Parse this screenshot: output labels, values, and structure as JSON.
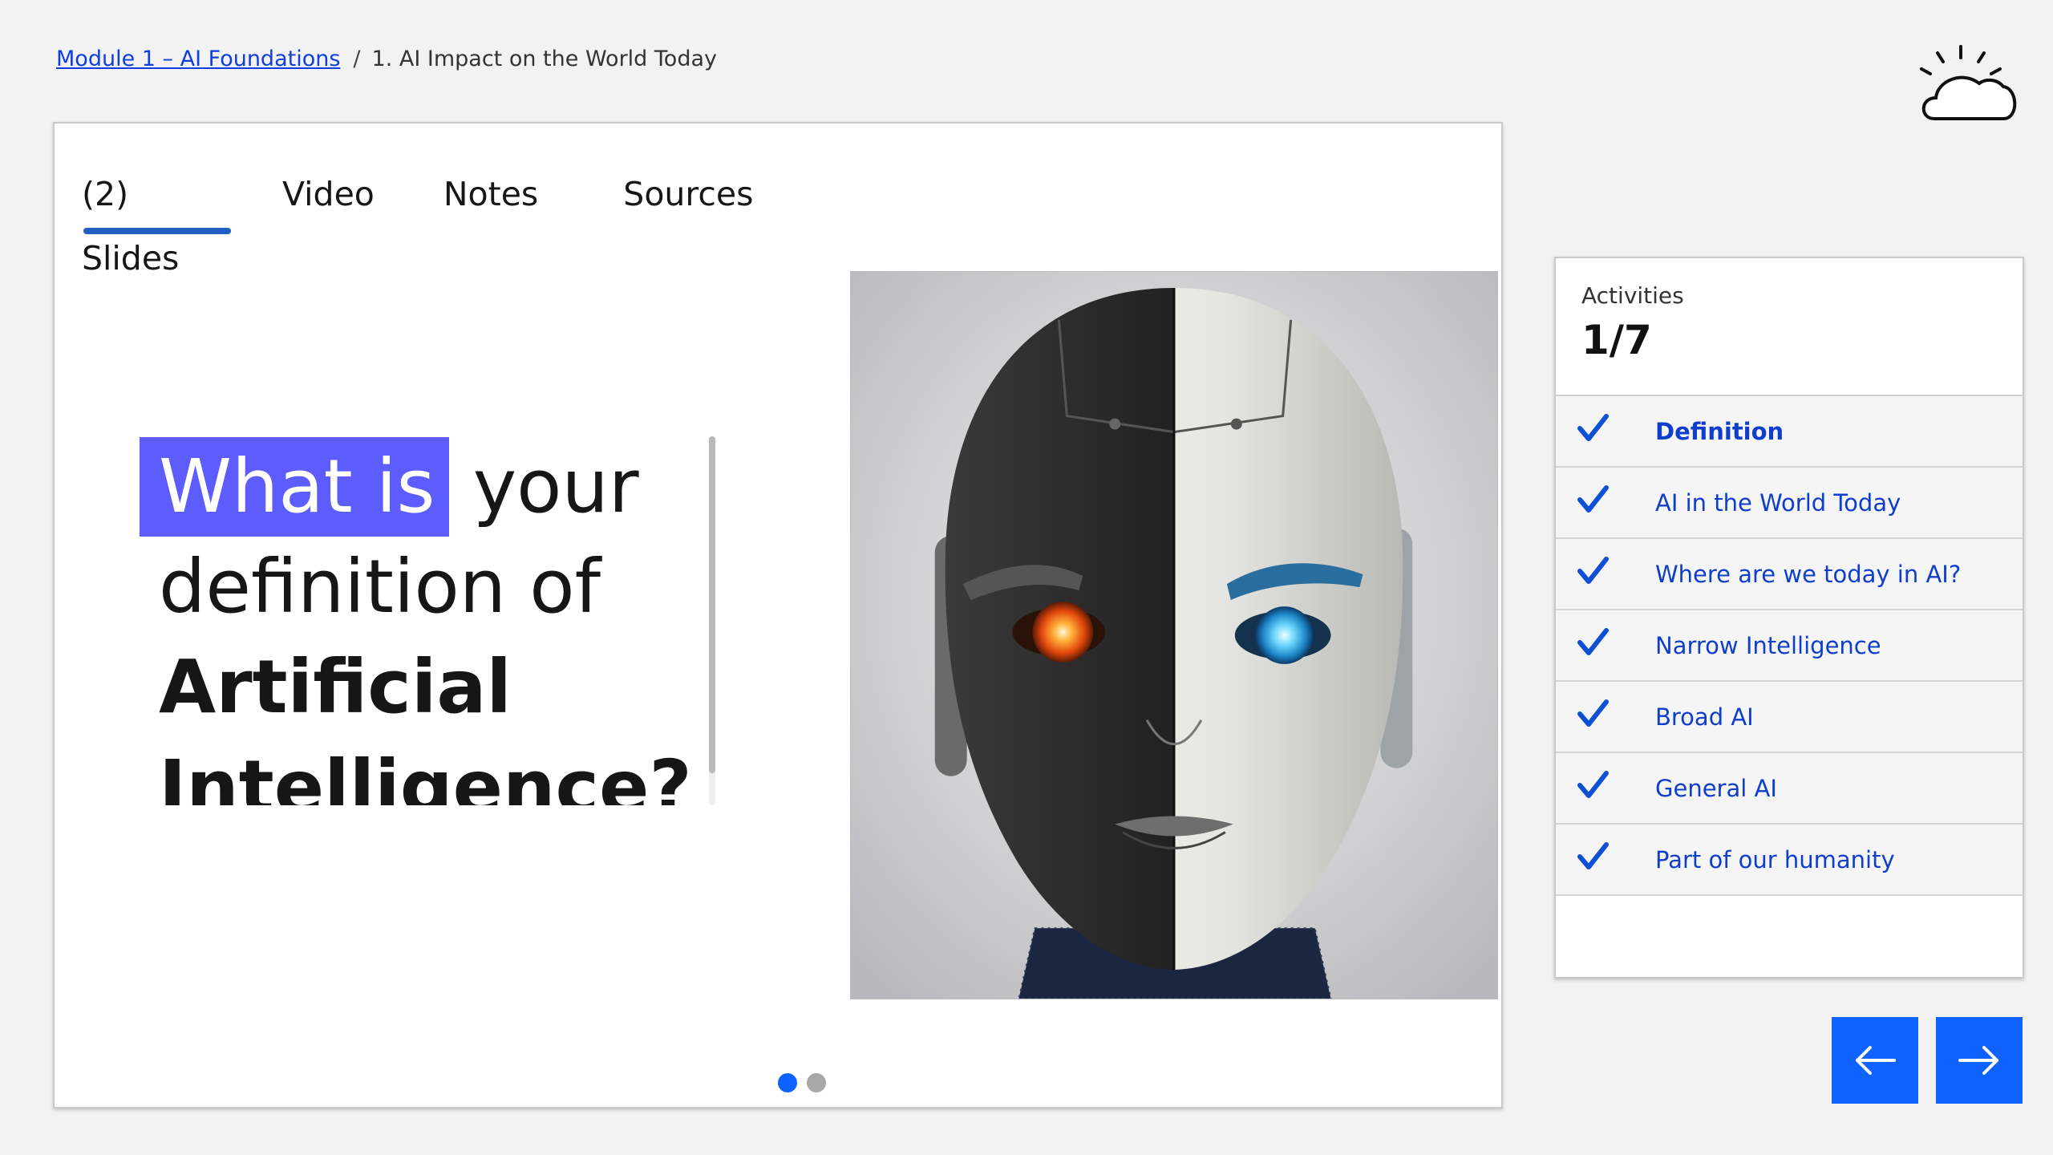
{
  "breadcrumb": {
    "module_link": "Module 1 – AI Foundations",
    "separator": "/",
    "current": "1. AI Impact on the World Today"
  },
  "tabs": [
    {
      "label": "(2) Slides",
      "active": true
    },
    {
      "label": "Video"
    },
    {
      "label": "Notes"
    },
    {
      "label": "Sources"
    }
  ],
  "slide": {
    "highlight": "What is",
    "line1_rest": "your",
    "line2": "definition of",
    "line3": "Artificial",
    "line4": "Intelligence?"
  },
  "pagination": {
    "total": 2,
    "current": 1
  },
  "activities": {
    "label": "Activities",
    "count": "1/7",
    "items": [
      {
        "label": "Definition",
        "current": true
      },
      {
        "label": "AI in the World Today"
      },
      {
        "label": "Where are we today in AI?"
      },
      {
        "label": "Narrow Intelligence"
      },
      {
        "label": "Broad AI"
      },
      {
        "label": "General AI"
      },
      {
        "label": "Part of our humanity"
      }
    ]
  },
  "colors": {
    "accent": "#0f62fe",
    "highlight": "#5c5cff",
    "tab_underline": "#1f5fbf"
  },
  "icons": {
    "logo": "cloud-sun-icon",
    "check": "checkmark-icon",
    "prev": "arrow-left-icon",
    "next": "arrow-right-icon"
  }
}
